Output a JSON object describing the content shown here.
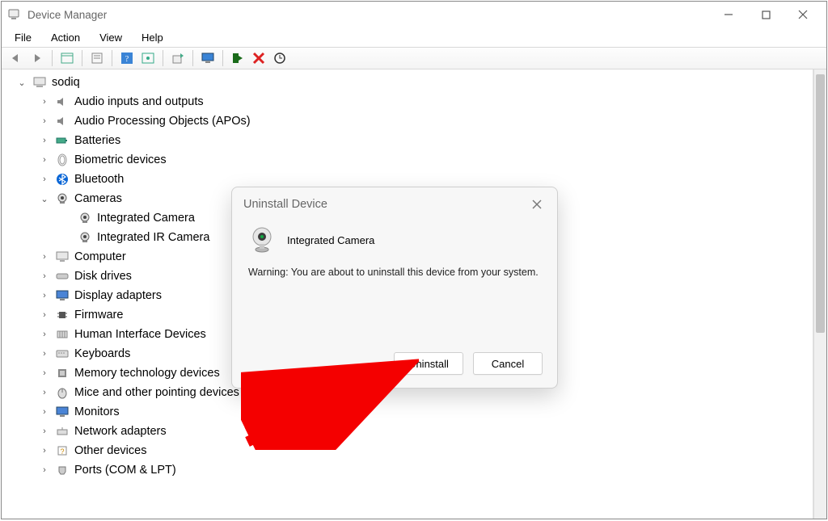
{
  "window": {
    "title": "Device Manager"
  },
  "menubar": {
    "file": "File",
    "action": "Action",
    "view": "View",
    "help": "Help"
  },
  "tree": {
    "root": "sodiq",
    "audio_io": "Audio inputs and outputs",
    "audio_apo": "Audio Processing Objects (APOs)",
    "batteries": "Batteries",
    "biometric": "Biometric devices",
    "bluetooth": "Bluetooth",
    "cameras": "Cameras",
    "cam_integrated": "Integrated Camera",
    "cam_ir": "Integrated IR Camera",
    "computer": "Computer",
    "disk": "Disk drives",
    "display": "Display adapters",
    "firmware": "Firmware",
    "hid": "Human Interface Devices",
    "keyboards": "Keyboards",
    "mem_tech": "Memory technology devices",
    "mice": "Mice and other pointing devices",
    "monitors": "Monitors",
    "network": "Network adapters",
    "other": "Other devices",
    "ports": "Ports (COM & LPT)"
  },
  "dialog": {
    "title": "Uninstall Device",
    "device": "Integrated Camera",
    "warning": "Warning: You are about to uninstall this device from your system.",
    "uninstall": "Uninstall",
    "cancel": "Cancel"
  }
}
